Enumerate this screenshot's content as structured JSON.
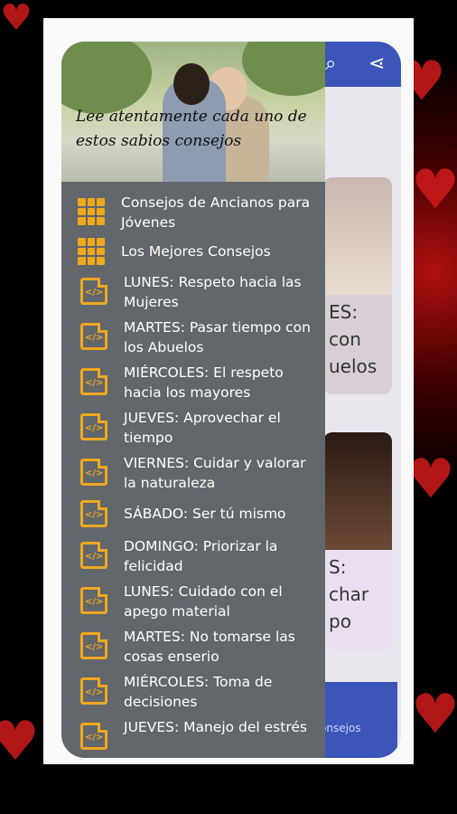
{
  "drawer": {
    "header_caption": "Lee atentamente cada uno de estos sabios consejos",
    "items": [
      {
        "label": "Consejos de Ancianos para Jóvenes",
        "icon": "grid-icon"
      },
      {
        "label": "Los Mejores Consejos",
        "icon": "grid-icon"
      },
      {
        "label": "LUNES: Respeto hacia las Mujeres",
        "icon": "code-file-icon"
      },
      {
        "label": "MARTES: Pasar tiempo con los Abuelos",
        "icon": "code-file-icon"
      },
      {
        "label": "MIÉRCOLES: El respeto hacia los mayores",
        "icon": "code-file-icon"
      },
      {
        "label": "JUEVES: Aprovechar el tiempo",
        "icon": "code-file-icon"
      },
      {
        "label": "VIERNES: Cuidar y valorar la naturaleza",
        "icon": "code-file-icon"
      },
      {
        "label": "SÁBADO: Ser tú mismo",
        "icon": "code-file-icon"
      },
      {
        "label": "DOMINGO: Priorizar la felicidad",
        "icon": "code-file-icon"
      },
      {
        "label": "LUNES: Cuidado con el apego material",
        "icon": "code-file-icon"
      },
      {
        "label": "MARTES: No tomarse las cosas enserio",
        "icon": "code-file-icon"
      },
      {
        "label": "MIÉRCOLES: Toma de decisiones",
        "icon": "code-file-icon"
      },
      {
        "label": "JUEVES: Manejo del estrés",
        "icon": "code-file-icon"
      }
    ]
  },
  "background_app": {
    "card1_text": "ES:\ncon\nuelos",
    "card2_text": "S:\nchar\npo",
    "bottom_button": "onsejos"
  },
  "colors": {
    "accent": "#f0a81c",
    "drawer_bg": "#62676c",
    "appbar": "#3b55b8"
  }
}
